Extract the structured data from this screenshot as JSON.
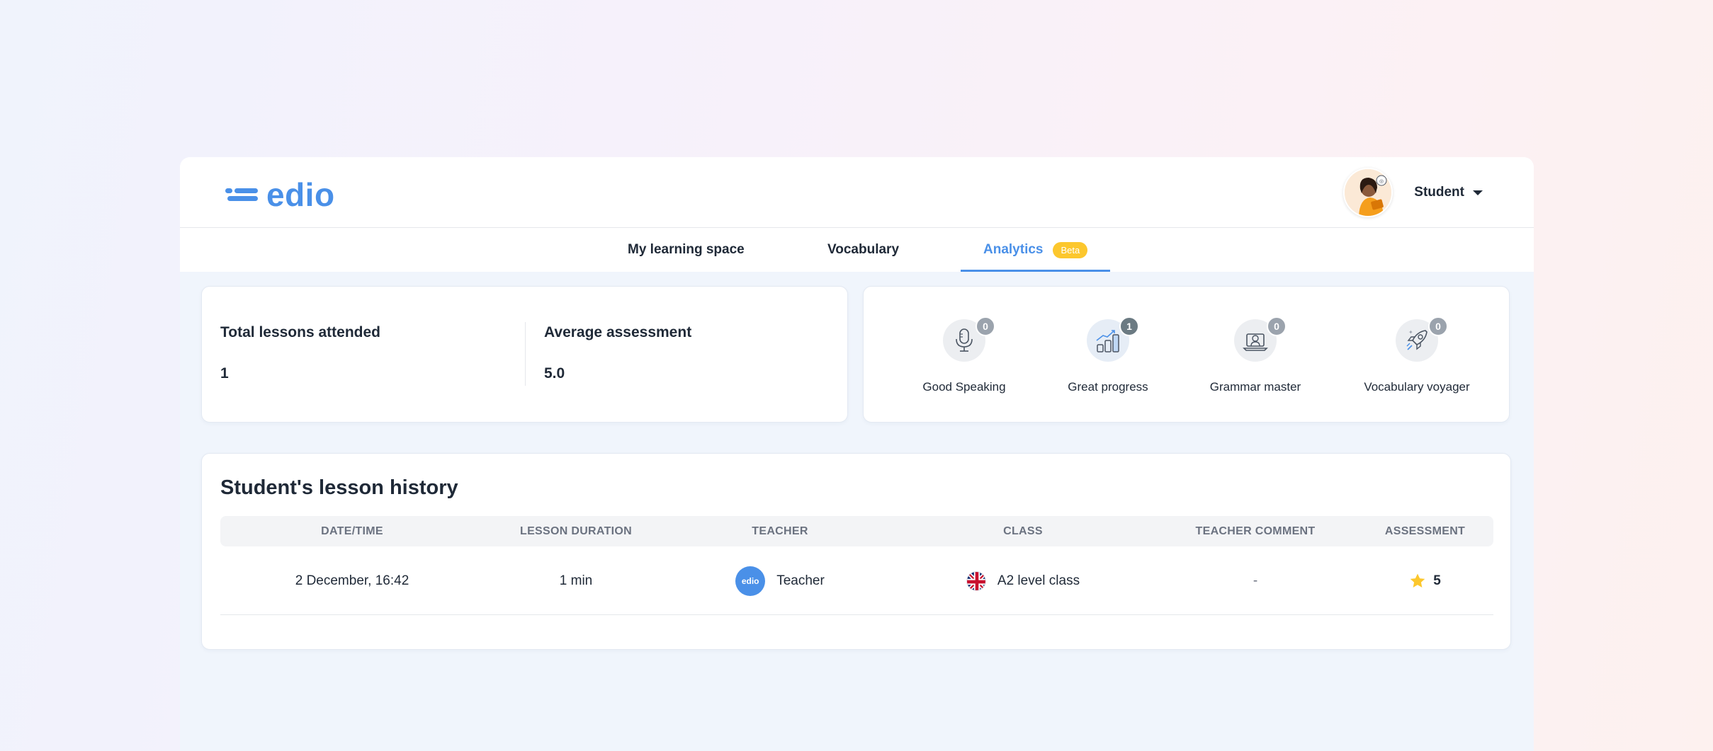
{
  "app": {
    "logo_text": "edio",
    "brand_color": "#4a90e8"
  },
  "header": {
    "user_label": "Student",
    "avatar_icon": "student-avatar"
  },
  "tabs": [
    {
      "label": "My learning space",
      "active": false
    },
    {
      "label": "Vocabulary",
      "active": false
    },
    {
      "label": "Analytics",
      "active": true,
      "badge": "Beta"
    }
  ],
  "stats": {
    "total_lessons_title": "Total lessons attended",
    "total_lessons_value": "1",
    "avg_assessment_title": "Average assessment",
    "avg_assessment_value": "5.0"
  },
  "badges": [
    {
      "label": "Good Speaking",
      "count": "0",
      "icon": "microphone-icon"
    },
    {
      "label": "Great progress",
      "count": "1",
      "icon": "growth-chart-icon"
    },
    {
      "label": "Grammar master",
      "count": "0",
      "icon": "laptop-icon"
    },
    {
      "label": "Vocabulary voyager",
      "count": "0",
      "icon": "rocket-icon"
    }
  ],
  "history": {
    "title": "Student's lesson history",
    "columns": [
      "Date/Time",
      "Lesson duration",
      "Teacher",
      "Class",
      "Teacher comment",
      "Assessment"
    ],
    "rows": [
      {
        "datetime": "2 December, 16:42",
        "duration": "1 min",
        "teacher_logo": "edio",
        "teacher": "Teacher",
        "class": "A2 level class",
        "comment": "-",
        "assessment": "5"
      }
    ]
  }
}
